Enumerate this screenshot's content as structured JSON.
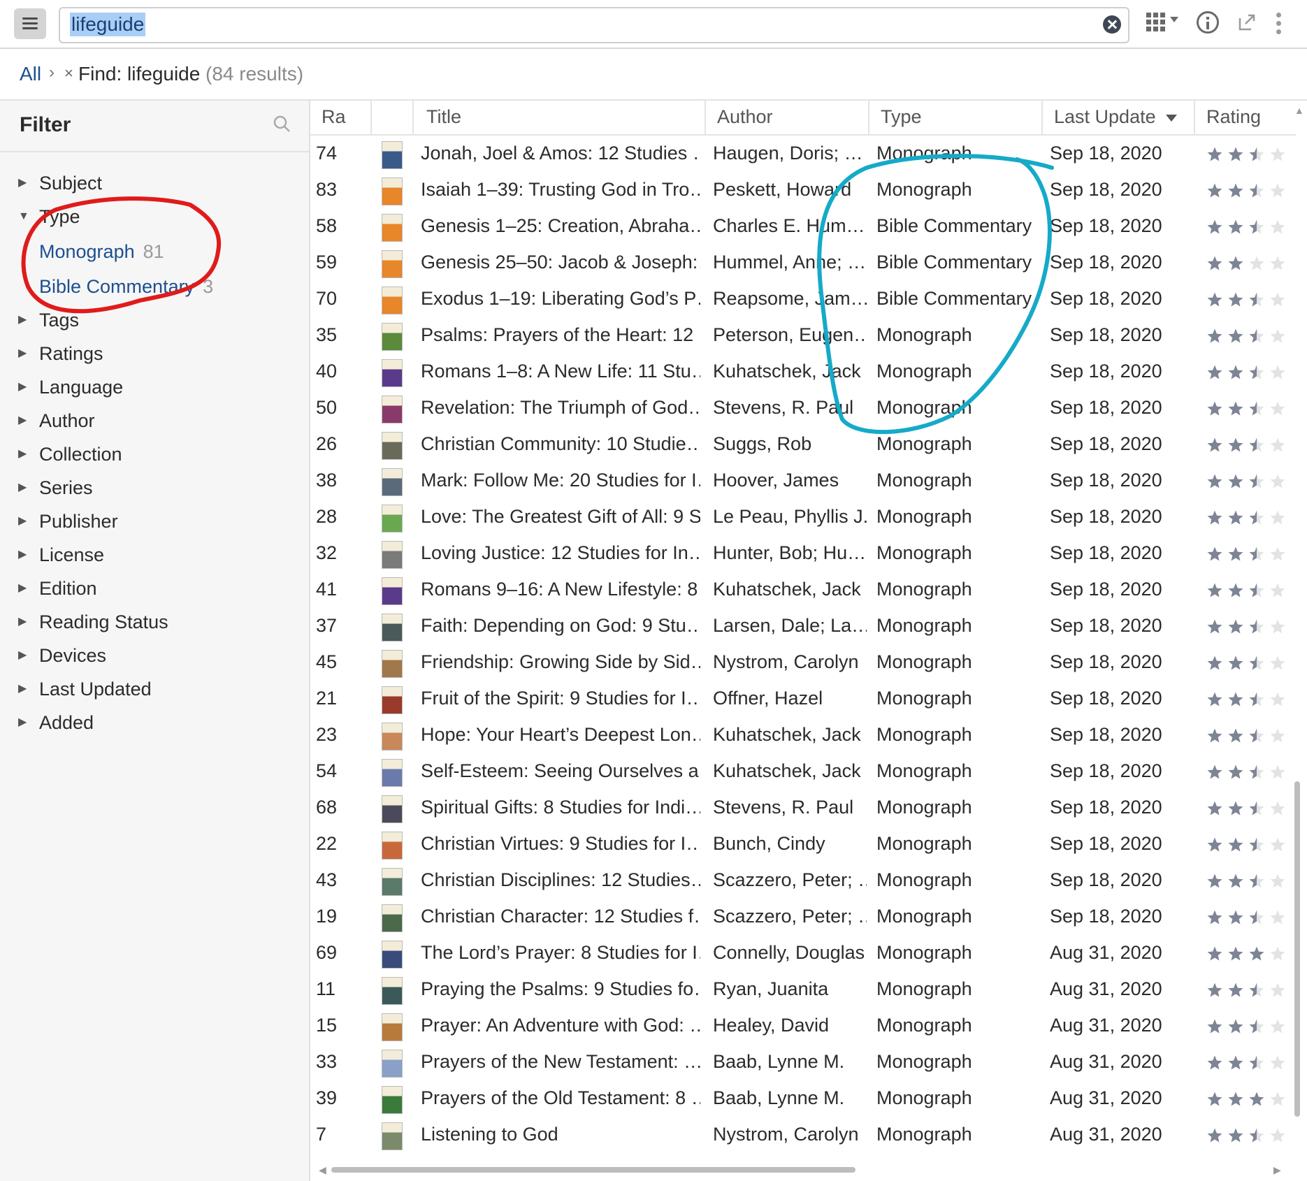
{
  "toolbar": {
    "menu_icon": "hamburger-menu-icon",
    "search_value": "lifeguide",
    "icons": [
      "clear-search-icon",
      "view-grid-icon",
      "info-icon",
      "popout-icon",
      "more-options-icon"
    ]
  },
  "breadcrumb": {
    "all": "All",
    "separator": "›",
    "remove": "×",
    "find": "Find: lifeguide",
    "count": "(84 results)"
  },
  "filter": {
    "title": "Filter",
    "type_options": [
      {
        "label": "Monograph",
        "count": "81"
      },
      {
        "label": "Bible Commentary",
        "count": "3"
      }
    ],
    "sections": [
      "Subject",
      "Type",
      "Tags",
      "Ratings",
      "Language",
      "Author",
      "Collection",
      "Series",
      "Publisher",
      "License",
      "Edition",
      "Reading Status",
      "Devices",
      "Last Updated",
      "Added"
    ]
  },
  "table": {
    "headers": {
      "rank": "Ra",
      "title": "Title",
      "author": "Author",
      "type": "Type",
      "last_update": "Last Update",
      "rating": "Rating"
    },
    "rows": [
      {
        "rank": "74",
        "title": "Jonah, Joel & Amos: 12 Studies …",
        "author": "Haugen, Doris; …",
        "type": "Monograph",
        "date": "Sep 18, 2020",
        "rating": 2.5,
        "cover": "#3a5a8a"
      },
      {
        "rank": "83",
        "title": "Isaiah 1–39: Trusting God in Tro…",
        "author": "Peskett, Howard",
        "type": "Monograph",
        "date": "Sep 18, 2020",
        "rating": 2.5,
        "cover": "#e8862a"
      },
      {
        "rank": "58",
        "title": "Genesis 1–25: Creation, Abraha…",
        "author": "Charles E. Hum…",
        "type": "Bible Commentary",
        "date": "Sep 18, 2020",
        "rating": 2.5,
        "cover": "#e8862a"
      },
      {
        "rank": "59",
        "title": "Genesis 25–50: Jacob & Joseph:…",
        "author": "Hummel, Anne; …",
        "type": "Bible Commentary",
        "date": "Sep 18, 2020",
        "rating": 2,
        "cover": "#e8862a"
      },
      {
        "rank": "70",
        "title": "Exodus 1–19: Liberating God’s P…",
        "author": "Reapsome, Jam…",
        "type": "Bible Commentary",
        "date": "Sep 18, 2020",
        "rating": 2.5,
        "cover": "#e8862a"
      },
      {
        "rank": "35",
        "title": "Psalms: Prayers of the Heart: 12 …",
        "author": "Peterson, Eugen…",
        "type": "Monograph",
        "date": "Sep 18, 2020",
        "rating": 2.5,
        "cover": "#5a8a3a"
      },
      {
        "rank": "40",
        "title": "Romans 1–8: A New Life: 11 Stu…",
        "author": "Kuhatschek, Jack",
        "type": "Monograph",
        "date": "Sep 18, 2020",
        "rating": 2.5,
        "cover": "#5a3a8a"
      },
      {
        "rank": "50",
        "title": "Revelation: The Triumph of God…",
        "author": "Stevens, R. Paul",
        "type": "Monograph",
        "date": "Sep 18, 2020",
        "rating": 2.5,
        "cover": "#8a3a6a"
      },
      {
        "rank": "26",
        "title": "Christian Community: 10 Studie…",
        "author": "Suggs, Rob",
        "type": "Monograph",
        "date": "Sep 18, 2020",
        "rating": 2.5,
        "cover": "#6a6a5a"
      },
      {
        "rank": "38",
        "title": "Mark: Follow Me: 20 Studies for I…",
        "author": "Hoover, James",
        "type": "Monograph",
        "date": "Sep 18, 2020",
        "rating": 2.5,
        "cover": "#5a6a7a"
      },
      {
        "rank": "28",
        "title": "Love: The Greatest Gift of All: 9 S…",
        "author": "Le Peau, Phyllis J.",
        "type": "Monograph",
        "date": "Sep 18, 2020",
        "rating": 2.5,
        "cover": "#6aa84f"
      },
      {
        "rank": "32",
        "title": "Loving Justice: 12 Studies for In…",
        "author": "Hunter, Bob; Hu…",
        "type": "Monograph",
        "date": "Sep 18, 2020",
        "rating": 2.5,
        "cover": "#7a7a7a"
      },
      {
        "rank": "41",
        "title": "Romans 9–16: A New Lifestyle: 8…",
        "author": "Kuhatschek, Jack",
        "type": "Monograph",
        "date": "Sep 18, 2020",
        "rating": 2.5,
        "cover": "#5a3a8a"
      },
      {
        "rank": "37",
        "title": "Faith: Depending on God: 9 Stu…",
        "author": "Larsen, Dale; La…",
        "type": "Monograph",
        "date": "Sep 18, 2020",
        "rating": 2.5,
        "cover": "#4a5a5a"
      },
      {
        "rank": "45",
        "title": "Friendship: Growing Side by Sid…",
        "author": "Nystrom, Carolyn",
        "type": "Monograph",
        "date": "Sep 18, 2020",
        "rating": 2.5,
        "cover": "#a0784a"
      },
      {
        "rank": "21",
        "title": "Fruit of the Spirit: 9 Studies for I…",
        "author": "Offner, Hazel",
        "type": "Monograph",
        "date": "Sep 18, 2020",
        "rating": 2.5,
        "cover": "#9a3a2a"
      },
      {
        "rank": "23",
        "title": "Hope: Your Heart’s Deepest Lon…",
        "author": "Kuhatschek, Jack",
        "type": "Monograph",
        "date": "Sep 18, 2020",
        "rating": 2.5,
        "cover": "#c8885a"
      },
      {
        "rank": "54",
        "title": "Self-Esteem: Seeing Ourselves a…",
        "author": "Kuhatschek, Jack",
        "type": "Monograph",
        "date": "Sep 18, 2020",
        "rating": 2.5,
        "cover": "#6a7aaa"
      },
      {
        "rank": "68",
        "title": "Spiritual Gifts: 8 Studies for Indi…",
        "author": "Stevens, R. Paul",
        "type": "Monograph",
        "date": "Sep 18, 2020",
        "rating": 2.5,
        "cover": "#4a4a5a"
      },
      {
        "rank": "22",
        "title": "Christian Virtues: 9 Studies for I…",
        "author": "Bunch, Cindy",
        "type": "Monograph",
        "date": "Sep 18, 2020",
        "rating": 2.5,
        "cover": "#c8683a"
      },
      {
        "rank": "43",
        "title": "Christian Disciplines: 12 Studies…",
        "author": "Scazzero, Peter; …",
        "type": "Monograph",
        "date": "Sep 18, 2020",
        "rating": 2.5,
        "cover": "#5a7a6a"
      },
      {
        "rank": "19",
        "title": "Christian Character: 12 Studies f…",
        "author": "Scazzero, Peter; …",
        "type": "Monograph",
        "date": "Sep 18, 2020",
        "rating": 2.5,
        "cover": "#4a6a4a"
      },
      {
        "rank": "69",
        "title": "The Lord’s Prayer: 8 Studies for I…",
        "author": "Connelly, Douglas",
        "type": "Monograph",
        "date": "Aug 31, 2020",
        "rating": 3,
        "cover": "#3a4a7a"
      },
      {
        "rank": "11",
        "title": "Praying the Psalms: 9 Studies fo…",
        "author": "Ryan, Juanita",
        "type": "Monograph",
        "date": "Aug 31, 2020",
        "rating": 2.5,
        "cover": "#3a5a5a"
      },
      {
        "rank": "15",
        "title": "Prayer: An Adventure with God: …",
        "author": "Healey, David",
        "type": "Monograph",
        "date": "Aug 31, 2020",
        "rating": 2.5,
        "cover": "#b87a3a"
      },
      {
        "rank": "33",
        "title": "Prayers of the New Testament: …",
        "author": "Baab, Lynne M.",
        "type": "Monograph",
        "date": "Aug 31, 2020",
        "rating": 2.5,
        "cover": "#8aa0c8"
      },
      {
        "rank": "39",
        "title": "Prayers of the Old Testament: 8 …",
        "author": "Baab, Lynne M.",
        "type": "Monograph",
        "date": "Aug 31, 2020",
        "rating": 3,
        "cover": "#3a7a3a"
      },
      {
        "rank": "7",
        "title": "Listening to God",
        "author": "Nystrom, Carolyn",
        "type": "Monograph",
        "date": "Aug 31, 2020",
        "rating": 2.5,
        "cover": "#7a8a6a"
      }
    ]
  },
  "colors": {
    "link": "#1d4f8f",
    "star_filled": "#7d8595",
    "star_empty": "#e3e3e3",
    "annotation_red": "#e01b1b",
    "annotation_cyan": "#15aac8",
    "selection": "#a9cef5"
  }
}
